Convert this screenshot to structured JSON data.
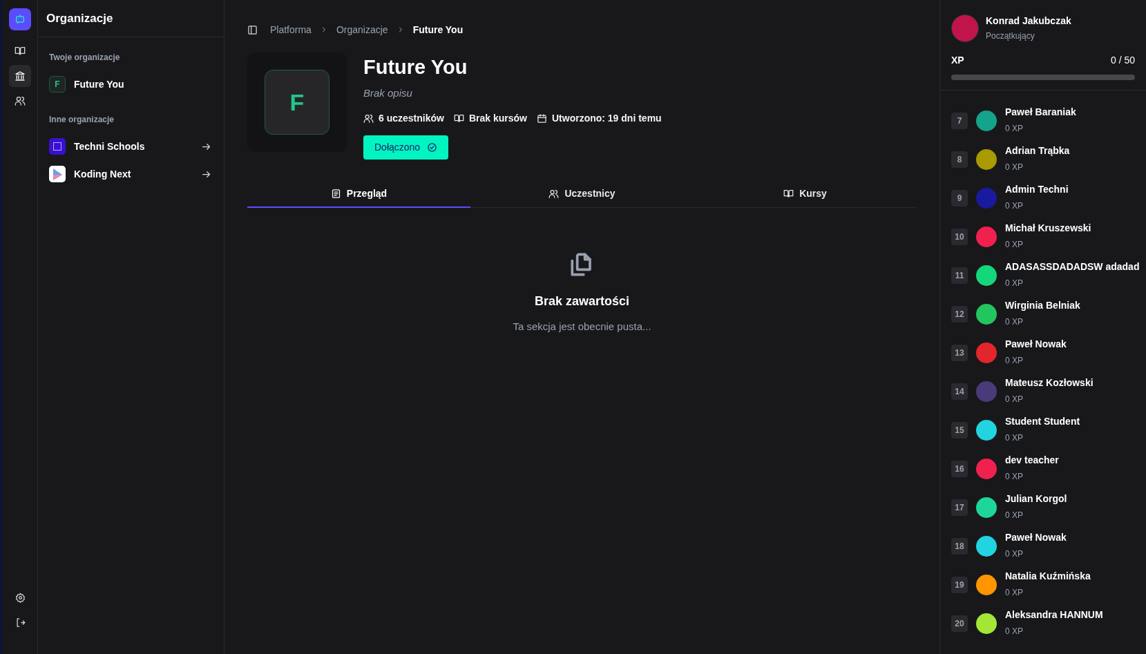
{
  "nav": {
    "items": [
      {
        "kind": "book",
        "selected": false
      },
      {
        "kind": "bank",
        "selected": true
      },
      {
        "kind": "users",
        "selected": false
      }
    ],
    "bottom": [
      {
        "kind": "settings"
      },
      {
        "kind": "logout"
      }
    ]
  },
  "sidebar": {
    "title": "Organizacje",
    "sections": [
      {
        "label": "Twoje organizacje",
        "items": [
          {
            "name": "Future You",
            "kind": "letter",
            "initial": "F"
          }
        ]
      },
      {
        "label": "Inne organizacje",
        "items": [
          {
            "name": "Techni Schools",
            "kind": "techni"
          },
          {
            "name": "Koding Next",
            "kind": "koding"
          }
        ]
      }
    ]
  },
  "breadcrumbs": [
    "Platforma",
    "Organizacje",
    "Future You"
  ],
  "organization": {
    "initial": "F",
    "name": "Future You",
    "description": "Brak opisu",
    "stats": [
      {
        "kind": "users",
        "text": "6 uczestników"
      },
      {
        "kind": "book",
        "text": "Brak kursów"
      },
      {
        "kind": "calendar",
        "text": "Utworzono: 19 dni temu"
      }
    ],
    "join_button": "Dołączono"
  },
  "tabs": [
    {
      "label": "Przegląd",
      "kind": "overview",
      "selected": true
    },
    {
      "label": "Uczestnicy",
      "kind": "users",
      "selected": false
    },
    {
      "label": "Kursy",
      "kind": "book",
      "selected": false
    }
  ],
  "empty_state": {
    "title": "Brak zawartości",
    "subtitle": "Ta sekcja jest obecnie pusta..."
  },
  "profile": {
    "name": "Konrad Jakubczak",
    "rank": "Początkujący",
    "color": "#c0144a",
    "xp_label": "XP",
    "xp_value": "0 / 50",
    "level": 0
  },
  "leaderboard": [
    {
      "rank": "7",
      "name": "Paweł Baraniak",
      "xp": "0 XP",
      "color": "#14a38b"
    },
    {
      "rank": "8",
      "name": "Adrian Trąbka",
      "xp": "0 XP",
      "color": "#a89a00"
    },
    {
      "rank": "9",
      "name": "Admin Techni",
      "xp": "0 XP",
      "color": "#1a1a9e"
    },
    {
      "rank": "10",
      "name": "Michał Kruszewski",
      "xp": "0 XP",
      "color": "#f0204f"
    },
    {
      "rank": "11",
      "name": "ADASASSDADADSW adadad",
      "xp": "0 XP",
      "color": "#14d67a"
    },
    {
      "rank": "12",
      "name": "Wirginia Belniak",
      "xp": "0 XP",
      "color": "#22c55e"
    },
    {
      "rank": "13",
      "name": "Paweł Nowak",
      "xp": "0 XP",
      "color": "#e3262b"
    },
    {
      "rank": "14",
      "name": "Mateusz Kozłowski",
      "xp": "0 XP",
      "color": "#4a3a7a"
    },
    {
      "rank": "15",
      "name": "Student Student",
      "xp": "0 XP",
      "color": "#22d3e0"
    },
    {
      "rank": "16",
      "name": "dev teacher",
      "xp": "0 XP",
      "color": "#f0204f"
    },
    {
      "rank": "17",
      "name": "Julian Korgol",
      "xp": "0 XP",
      "color": "#1fd69a"
    },
    {
      "rank": "18",
      "name": "Paweł Nowak",
      "xp": "0 XP",
      "color": "#22d3e0"
    },
    {
      "rank": "19",
      "name": "Natalia Kuźmińska",
      "xp": "0 XP",
      "color": "#ff9500"
    },
    {
      "rank": "20",
      "name": "Aleksandra HANNUM",
      "xp": "0 XP",
      "color": "#a3e635"
    }
  ]
}
